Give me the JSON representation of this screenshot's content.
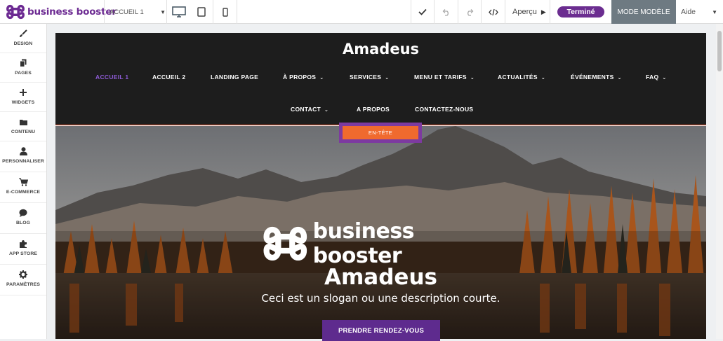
{
  "app": {
    "brand": "business booster",
    "page_select": "ACCUEIL 1",
    "apercu_label": "Aperçu",
    "termine_label": "Terminé",
    "mode_label": "MODE MODÈLE",
    "aide_label": "Aide",
    "accent_color": "#6b2d90"
  },
  "sidebar": {
    "items": [
      {
        "label": "DESIGN",
        "icon": "brush-icon"
      },
      {
        "label": "PAGES",
        "icon": "pages-icon"
      },
      {
        "label": "WIDGETS",
        "icon": "plus-icon"
      },
      {
        "label": "CONTENU",
        "icon": "folder-icon"
      },
      {
        "label": "PERSONNALISER",
        "icon": "user-icon"
      },
      {
        "label": "E-COMMERCE",
        "icon": "cart-icon"
      },
      {
        "label": "BLOG",
        "icon": "chat-icon"
      },
      {
        "label": "APP STORE",
        "icon": "puzzle-icon"
      },
      {
        "label": "PARAMÈTRES",
        "icon": "gear-icon"
      }
    ]
  },
  "site": {
    "title": "Amadeus",
    "nav_row1": [
      {
        "label": "ACCUEIL 1",
        "dropdown": false
      },
      {
        "label": "ACCUEIL 2",
        "dropdown": false
      },
      {
        "label": "LANDING PAGE",
        "dropdown": false
      },
      {
        "label": "À PROPOS",
        "dropdown": true
      },
      {
        "label": "SERVICES",
        "dropdown": true
      },
      {
        "label": "MENU ET TARIFS",
        "dropdown": true
      },
      {
        "label": "ACTUALITÉS",
        "dropdown": true
      },
      {
        "label": "ÉVÉNEMENTS",
        "dropdown": true
      },
      {
        "label": "FAQ",
        "dropdown": true
      }
    ],
    "nav_row2": [
      {
        "label": "CONTACT",
        "dropdown": true
      },
      {
        "label": "A PROPOS",
        "dropdown": false
      },
      {
        "label": "CONTACTEZ-NOUS",
        "dropdown": false
      }
    ],
    "section_tag": "EN-TÊTE",
    "hero": {
      "logo_text": "business booster",
      "title": "Amadeus",
      "slogan": "Ceci est un slogan ou une description courte.",
      "cta": "PRENDRE RENDEZ-VOUS"
    }
  }
}
